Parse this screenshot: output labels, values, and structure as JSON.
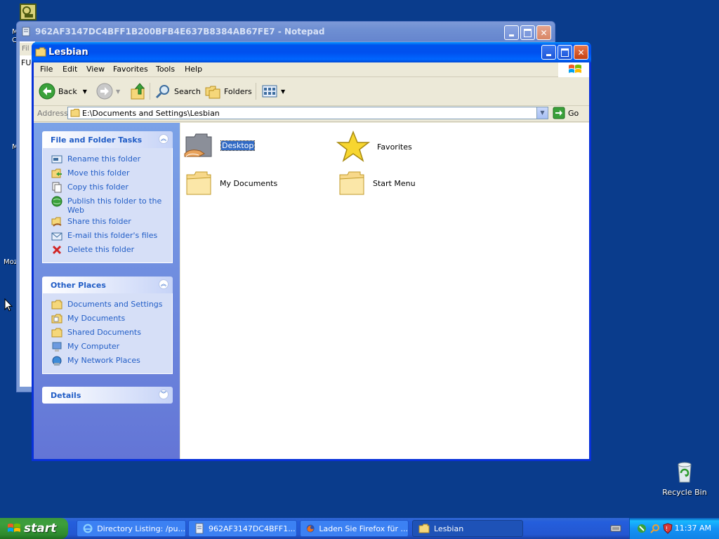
{
  "desktop": {
    "recycle_bin_label": "Recycle Bin",
    "edge_labels": [
      "M",
      "C",
      "M",
      "Moz"
    ]
  },
  "notepad": {
    "title": "962AF3147DC4BFF1B200BFB4E637B8384AB67FE7 - Notepad",
    "menu_fragment": "Fil",
    "text_fragment": "FU"
  },
  "explorer": {
    "title": "Lesbian",
    "menu": [
      "File",
      "Edit",
      "View",
      "Favorites",
      "Tools",
      "Help"
    ],
    "toolbar": {
      "back": "Back",
      "search": "Search",
      "folders": "Folders"
    },
    "address": {
      "label": "Address",
      "value": "E:\\Documents and Settings\\Lesbian",
      "go": "Go"
    },
    "file_tasks": {
      "title": "File and Folder Tasks",
      "items": [
        "Rename this folder",
        "Move this folder",
        "Copy this folder",
        "Publish this folder to the Web",
        "Share this folder",
        "E-mail this folder's files",
        "Delete this folder"
      ]
    },
    "other_places": {
      "title": "Other Places",
      "items": [
        "Documents and Settings",
        "My Documents",
        "Shared Documents",
        "My Computer",
        "My Network Places"
      ]
    },
    "details": {
      "title": "Details"
    },
    "items": [
      "Desktop",
      "Favorites",
      "My Documents",
      "Start Menu"
    ],
    "selected_item": "Desktop"
  },
  "taskbar": {
    "start_label": "start",
    "tasks": [
      "Directory Listing: /pu...",
      "962AF3147DC4BFF1...",
      "Laden Sie Firefox für ...",
      "Lesbian"
    ],
    "active_task": "Lesbian",
    "clock": "11:37 AM"
  }
}
